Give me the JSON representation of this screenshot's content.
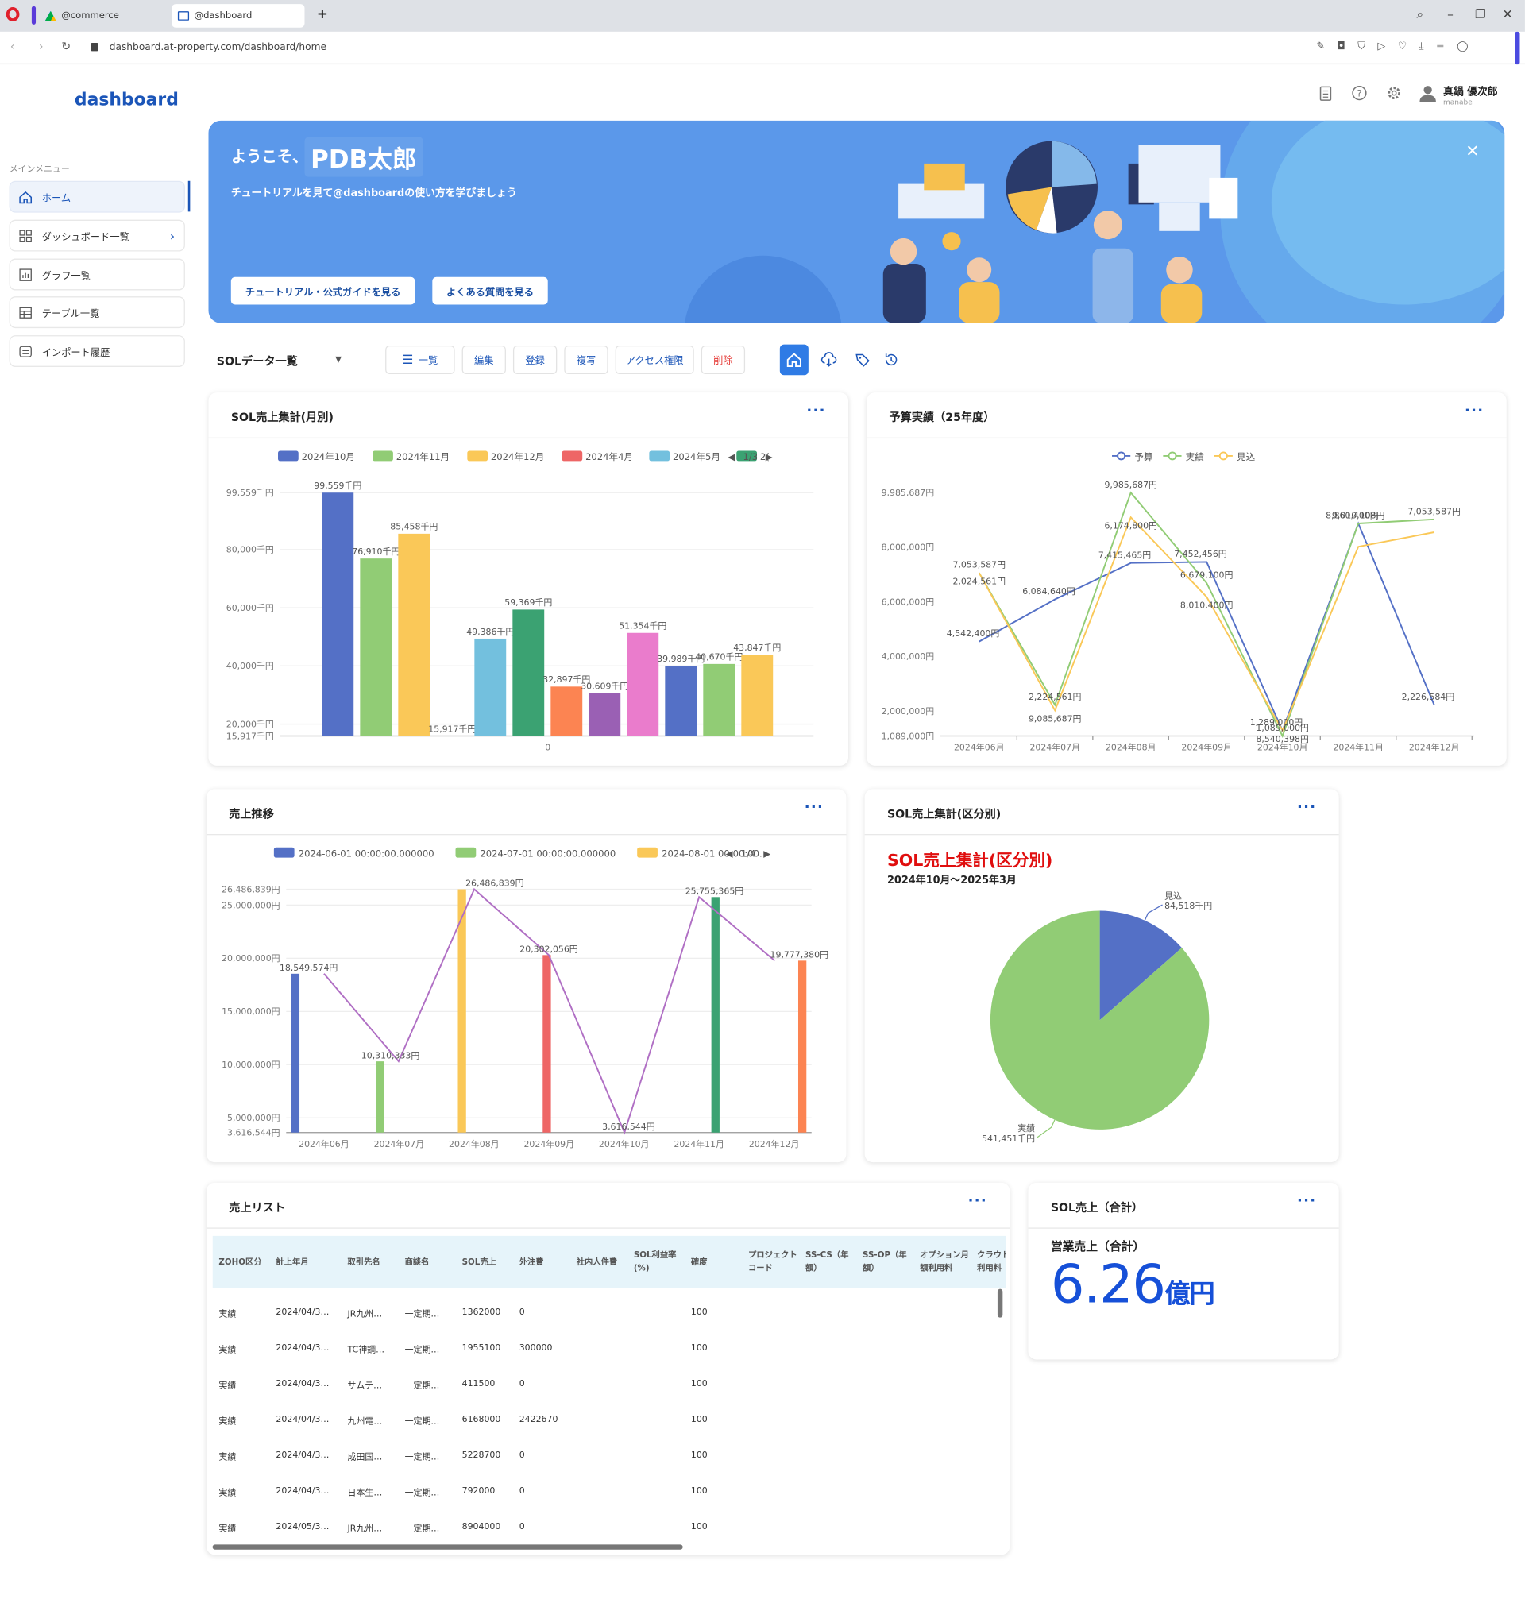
{
  "browser": {
    "tabs": [
      {
        "label": "@commerce"
      },
      {
        "label": "@dashboard"
      }
    ],
    "url": "dashboard.at-property.com/dashboard/home"
  },
  "app": {
    "logo": "dashboard",
    "menu_heading": "メインメニュー",
    "sidebar": [
      {
        "label": "ホーム",
        "icon": "home-icon"
      },
      {
        "label": "ダッシュボード一覧",
        "icon": "dashboard-grid-icon"
      },
      {
        "label": "グラフ一覧",
        "icon": "chart-icon"
      },
      {
        "label": "テーブル一覧",
        "icon": "table-icon"
      },
      {
        "label": "インポート履歴",
        "icon": "import-icon"
      }
    ],
    "user": {
      "name": "真鍋 優次郎",
      "id": "manabe"
    }
  },
  "banner": {
    "welcome": "ようこそ、",
    "name": "PDB太郎",
    "subtitle": "チュートリアルを見て@dashboardの使い方を学びましょう",
    "btn_tutorial": "チュートリアル・公式ガイドを見る",
    "btn_faq": "よくある質問を見る"
  },
  "toolbar": {
    "dashboard_name": "SOLデータ一覧",
    "list": "一覧",
    "edit": "編集",
    "register": "登録",
    "copy": "複写",
    "access": "アクセス権限",
    "delete": "削除",
    "colors": {
      "accent": "#1b55b8",
      "danger": "#e53935",
      "active_icon_bg": "#2f7be5"
    }
  },
  "card_monthly": {
    "title": "SOL売上集計(月別)",
    "pager": "1/3",
    "chart_data": {
      "type": "bar",
      "legend": [
        "2024年10月",
        "2024年11月",
        "2024年12月",
        "2024年4月",
        "2024年5月",
        "2("
      ],
      "y_ticks": [
        "99,559千円",
        "80,000千円",
        "60,000千円",
        "40,000千円",
        "20,000千円",
        "15,917千円"
      ],
      "x_label": "0",
      "bars": [
        {
          "value": 99559,
          "label": "99,559千円",
          "color": "#5470c6"
        },
        {
          "value": 76910,
          "label": "76,910千円",
          "color": "#91cc75"
        },
        {
          "value": 85458,
          "label": "85,458千円",
          "color": "#fac858"
        },
        {
          "value": 15917,
          "label": "15,917千円",
          "color": "#ee6666"
        },
        {
          "value": 49386,
          "label": "49,386千円",
          "color": "#73c0de"
        },
        {
          "value": 59369,
          "label": "59,369千円",
          "color": "#3ba272"
        },
        {
          "value": 32897,
          "label": "32,897千円",
          "color": "#fc8452"
        },
        {
          "value": 30609,
          "label": "30,609千円",
          "color": "#9a60b4"
        },
        {
          "value": 51354,
          "label": "51,354千円",
          "color": "#ea7ccc"
        },
        {
          "value": 39989,
          "label": "39,989千円",
          "color": "#5470c6"
        },
        {
          "value": 40670,
          "label": "40,670千円",
          "color": "#91cc75"
        },
        {
          "value": 43847,
          "label": "43,847千円",
          "color": "#fac858"
        }
      ]
    }
  },
  "card_budget": {
    "title": "予算実績（25年度）",
    "chart_data": {
      "type": "line",
      "series_names": [
        "予算",
        "実績",
        "見込"
      ],
      "x": [
        "2024年06月",
        "2024年07月",
        "2024年08月",
        "2024年09月",
        "2024年10月",
        "2024年11月",
        "2024年12月"
      ],
      "y_ticks": [
        "9,985,687円",
        "8,000,000円",
        "6,000,000円",
        "4,000,000円",
        "2,000,000円",
        "1,089,000円"
      ],
      "series": [
        {
          "name": "予算",
          "color": "#5470c6",
          "values": [
            4542400,
            6084640,
            7415465,
            7452456,
            1289000,
            8860400,
            2226584
          ]
        },
        {
          "name": "実績",
          "color": "#91cc75",
          "values": [
            7053587,
            2224561,
            9985687,
            6679100,
            1089000,
            8860400,
            9010108
          ]
        },
        {
          "name": "見込",
          "color": "#fac858",
          "values": [
            7053587,
            2024561,
            9085687,
            6174800,
            1289000,
            8010400,
            8540398
          ]
        }
      ],
      "labels": [
        "4,542,400円",
        "6,084,640円",
        "7,415,465円",
        "7,452,456円",
        "1,289,000円",
        "8,860,400円",
        "2,226,584円",
        "7,053,587円",
        "2,224,561円",
        "9,985,687円",
        "6,679,100円",
        "1,089,000円",
        "9,010,108円",
        "7,053,587円",
        "2,024,561円",
        "9,085,687円",
        "6,174,800円",
        "8,010,400円",
        "8,540,398円"
      ]
    }
  },
  "card_trend": {
    "title": "売上推移",
    "pager": "1/4",
    "chart_data": {
      "type": "bar",
      "legend": [
        "2024-06-01 00:00:00.000000",
        "2024-07-01 00:00:00.000000",
        "2024-08-01 00:00:00."
      ],
      "x": [
        "2024年06月",
        "2024年07月",
        "2024年08月",
        "2024年09月",
        "2024年10月",
        "2024年11月",
        "2024年12月"
      ],
      "y_ticks": [
        "26,486,839円",
        "25,000,000円",
        "20,000,000円",
        "15,000,000円",
        "10,000,000円",
        "5,000,000円",
        "3,616,544円"
      ],
      "bars": [
        {
          "value": 18549574,
          "label": "18,549,574円",
          "color": "#5470c6"
        },
        {
          "value": 10310333,
          "label": "10,310,333円",
          "color": "#91cc75"
        },
        {
          "value": 26486839,
          "label": "26,486,839円",
          "color": "#fac858"
        },
        {
          "value": 20302056,
          "label": "20,302,056円",
          "color": "#ee6666"
        },
        {
          "value": 3616544,
          "label": "3,616,544円",
          "color": "#73c0de"
        },
        {
          "value": 25755365,
          "label": "25,755,365円",
          "color": "#3ba272"
        },
        {
          "value": 19777380,
          "label": "19,777,380円",
          "color": "#fc8452"
        }
      ],
      "line_color": "#b06fc4"
    }
  },
  "card_pie": {
    "title": "SOL売上集計(区分別)",
    "heading": "SOL売上集計(区分別)",
    "period": "2024年10月～2025年3月",
    "chart_data": {
      "type": "pie",
      "slices": [
        {
          "name": "見込",
          "value": 84518,
          "label": "84,518千円",
          "color": "#5470c6"
        },
        {
          "name": "実績",
          "value": 541451,
          "label": "541,451千円",
          "color": "#91cc75"
        }
      ]
    }
  },
  "card_list": {
    "title": "売上リスト",
    "columns": [
      "ZOHO区分",
      "計上年月",
      "取引先名",
      "商談名",
      "SOL売上",
      "外注費",
      "社内人件費",
      "SOL利益率 (%)",
      "確度",
      "プロジェクトコード",
      "SS-CS（年額）",
      "SS-OP（年額）",
      "オプション月額利用料",
      "クラウド月額利用料"
    ],
    "rows": [
      [
        "実績",
        "2024/04/3…",
        "JR九州…",
        "一定期…",
        "1362000",
        "0",
        "100"
      ],
      [
        "実績",
        "2024/04/3…",
        "TC神鋼…",
        "一定期…",
        "1955100",
        "300000",
        "100"
      ],
      [
        "実績",
        "2024/04/3…",
        "サムテ…",
        "一定期…",
        "411500",
        "0",
        "100"
      ],
      [
        "実績",
        "2024/04/3…",
        "九州電…",
        "一定期…",
        "6168000",
        "2422670",
        "100"
      ],
      [
        "実績",
        "2024/04/3…",
        "成田国…",
        "一定期…",
        "5228700",
        "0",
        "100"
      ],
      [
        "実績",
        "2024/04/3…",
        "日本生…",
        "一定期…",
        "792000",
        "0",
        "100"
      ],
      [
        "実績",
        "2024/05/3…",
        "JR九州…",
        "一定期…",
        "8904000",
        "0",
        "100"
      ]
    ]
  },
  "card_total": {
    "title": "SOL売上（合計）",
    "label": "営業売上（合計）",
    "value": "6.26",
    "unit": "億円"
  }
}
